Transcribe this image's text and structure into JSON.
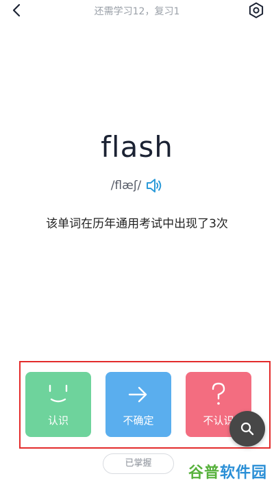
{
  "header": {
    "title": "还需学习12，复习1",
    "back_icon": "back-arrow-icon",
    "settings_icon": "gear-icon"
  },
  "word": {
    "text": "flash",
    "phonetic": "/flæʃ/",
    "audio_icon": "speaker-icon",
    "frequency_note": "该单词在历年通用考试中出现了3次"
  },
  "actions": {
    "know": {
      "label": "认识",
      "icon": "smile-icon",
      "color": "#6ed39c"
    },
    "unsure": {
      "label": "不确定",
      "icon": "arrow-right-icon",
      "color": "#5aaeee"
    },
    "unknown": {
      "label": "不认识",
      "icon": "question-icon",
      "color": "#f36d80"
    }
  },
  "search_icon": "search-icon",
  "mastered_button": "已掌握",
  "watermark": {
    "part1": "谷普",
    "part2": "软件园"
  }
}
